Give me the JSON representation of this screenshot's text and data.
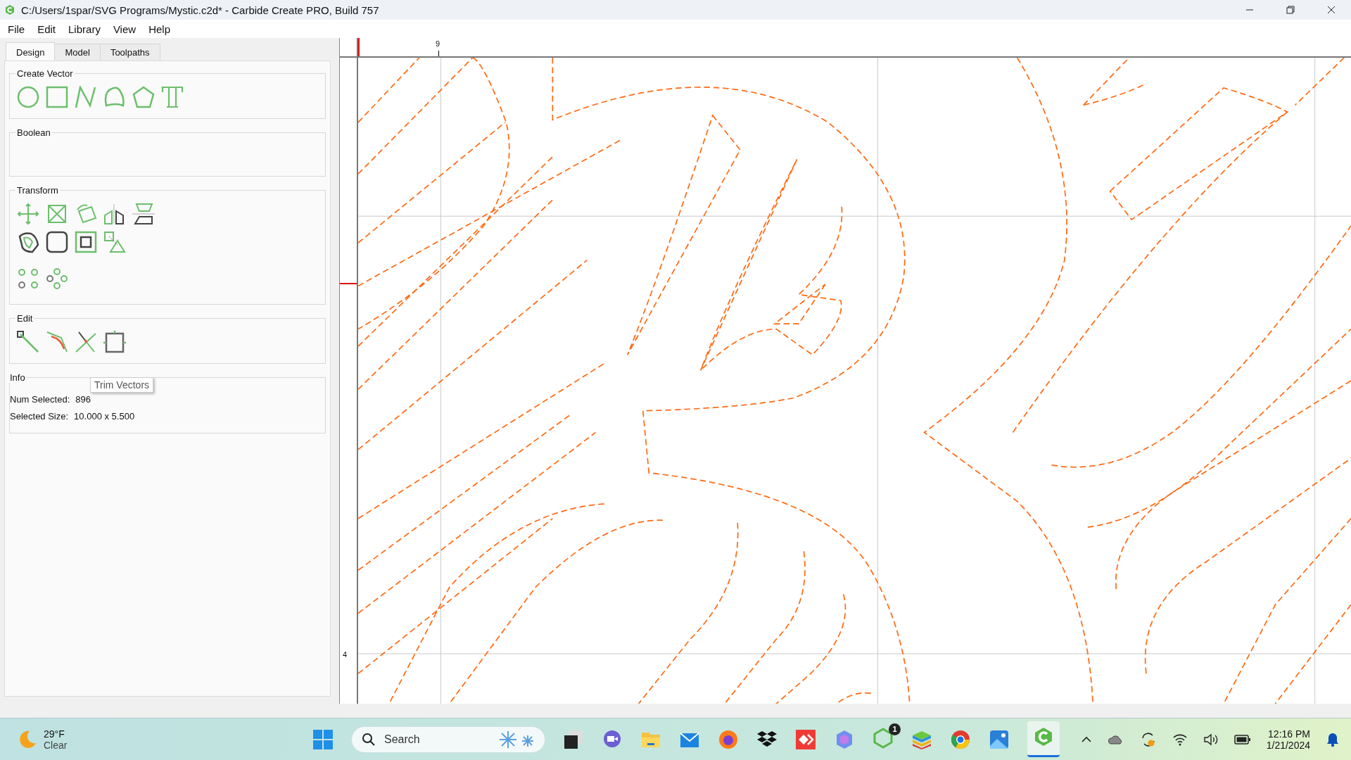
{
  "window": {
    "title": "C:/Users/1spar/SVG Programs/Mystic.c2d* - Carbide Create PRO, Build 757"
  },
  "menu": [
    "File",
    "Edit",
    "Library",
    "View",
    "Help"
  ],
  "tabs": [
    {
      "label": "Design",
      "selected": true
    },
    {
      "label": "Model",
      "selected": false
    },
    {
      "label": "Toolpaths",
      "selected": false
    }
  ],
  "sections": [
    {
      "title": "Create Vector",
      "kind": "create"
    },
    {
      "title": "Boolean",
      "kind": "boolean"
    },
    {
      "title": "Transform",
      "kind": "transform"
    },
    {
      "title": "Edit",
      "kind": "edit"
    },
    {
      "title": "Info",
      "kind": "info",
      "rows": [
        {
          "label": "Num Selected:",
          "value": "896"
        },
        {
          "label": "Selected Size:",
          "value": "10.000 x 5.500"
        }
      ]
    }
  ],
  "tooltip": "Trim Vectors",
  "canvas": {
    "top_ruler_label": "9",
    "left_ruler_label": "4"
  },
  "taskbar": {
    "temperature": "29°F",
    "condition": "Clear",
    "search": {
      "placeholder": "Search"
    },
    "badge": "1",
    "time": "12:16 PM",
    "date": "1/21/2024"
  }
}
